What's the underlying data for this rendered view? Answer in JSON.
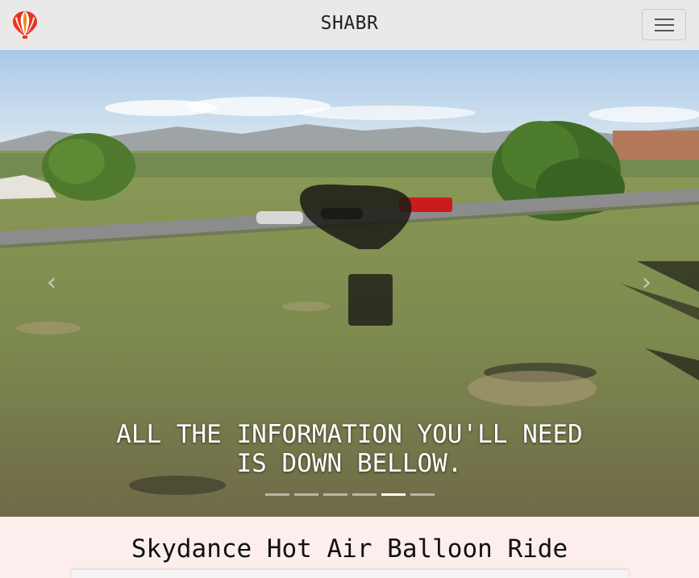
{
  "navbar": {
    "brand_title": "SHABR",
    "logo_icon": "hot-air-balloon-icon",
    "menu_icon": "hamburger-menu-icon"
  },
  "carousel": {
    "caption_line1": "ALL THE INFORMATION YOU'LL NEED",
    "caption_line2": "IS DOWN BELLOW.",
    "prev_icon": "chevron-left-icon",
    "next_icon": "chevron-right-icon",
    "prev_glyph": "‹",
    "next_glyph": "›",
    "slide_count": 6,
    "active_slide": 5
  },
  "section": {
    "title": "Skydance Hot Air Balloon Ride"
  },
  "colors": {
    "navbar_bg": "#e9e9e9",
    "section_bg": "#fdeeee",
    "logo_red": "#e8331f",
    "logo_orange": "#f28a1a"
  }
}
